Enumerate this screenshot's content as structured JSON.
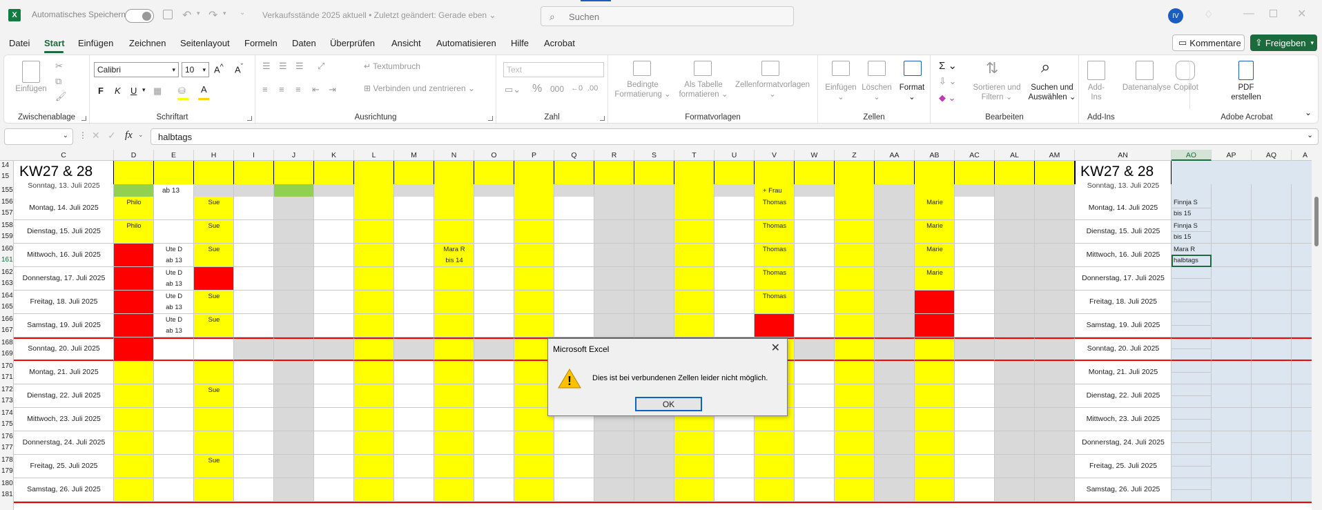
{
  "titlebar": {
    "logo": "X",
    "autosave_label": "Automatisches Speichern",
    "doc_title": "Verkaufsstände 2025 aktuell  •  Zuletzt geändert: Gerade eben ⌄",
    "search_placeholder": "Suchen",
    "avatar": "IV"
  },
  "menu": {
    "tabs": [
      "Datei",
      "Start",
      "Einfügen",
      "Zeichnen",
      "Seitenlayout",
      "Formeln",
      "Daten",
      "Überprüfen",
      "Ansicht",
      "Automatisieren",
      "Hilfe",
      "Acrobat"
    ],
    "active_tab": "Start",
    "kommentare": "Kommentare",
    "freigeben": "Freigeben"
  },
  "ribbon": {
    "groups": [
      "Zwischenablage",
      "Schriftart",
      "Ausrichtung",
      "Zahl",
      "Formatvorlagen",
      "Zellen",
      "Bearbeiten",
      "Add-Ins",
      "Adobe Acrobat"
    ],
    "font_name": "Calibri",
    "font_size": "10",
    "number_format": "Text",
    "paste_label": "Einfügen",
    "wrap_text": "Textumbruch",
    "merge_center": "Verbinden und zentrieren",
    "conditional_formatting": [
      "Bedingte",
      "Formatierung"
    ],
    "format_as_table": [
      "Als Tabelle",
      "formatieren"
    ],
    "cell_styles": "Zellenformatvorlagen",
    "insert_cells": "Einfügen",
    "delete_cells": "Löschen",
    "format_cells": "Format",
    "sort_filter": [
      "Sortieren und",
      "Filtern"
    ],
    "find_select": [
      "Suchen und",
      "Auswählen"
    ],
    "addins": [
      "Add-",
      "Ins"
    ],
    "data_analysis": "Datenanalyse",
    "copilot": "Copilot",
    "pdf": [
      "PDF",
      "erstellen"
    ],
    "bold": "F",
    "italic": "K",
    "underline": "U"
  },
  "formula_bar": {
    "name_box": "",
    "fx": "fx",
    "content": "halbtags"
  },
  "sheet": {
    "columns": [
      "C",
      "D",
      "E",
      "H",
      "I",
      "J",
      "K",
      "L",
      "M",
      "N",
      "O",
      "P",
      "Q",
      "R",
      "S",
      "T",
      "U",
      "V",
      "W",
      "Z",
      "AA",
      "AB",
      "AC",
      "AL",
      "AM",
      "AN",
      "AO",
      "AP",
      "AQ",
      "A"
    ],
    "header_label": "KW27 & 28",
    "frozen_rows": [
      "14",
      "15"
    ],
    "partial_row": {
      "row": "155",
      "date": "Sonntag, 13. Juli 2025",
      "E": "ab 13",
      "V": "+ Frau"
    },
    "days": [
      {
        "rows": [
          "156",
          "157"
        ],
        "date": "Montag, 14. Juli 2025",
        "D": "Philo",
        "E": [
          "",
          ""
        ],
        "H": "Sue",
        "N": [
          "",
          ""
        ],
        "V": "Thomas",
        "AB": "Marie",
        "AO": [
          "Finnja S",
          "bis 15"
        ]
      },
      {
        "rows": [
          "158",
          "159"
        ],
        "date": "Dienstag, 15. Juli 2025",
        "D": "Philo",
        "E": [
          "",
          ""
        ],
        "H": "Sue",
        "N": [
          "",
          ""
        ],
        "V": "Thomas",
        "AB": "Marie",
        "AO": [
          "Finnja S",
          "bis 15"
        ]
      },
      {
        "rows": [
          "160",
          "161"
        ],
        "date": "Mittwoch, 16. Juli 2025",
        "D": "",
        "E": [
          "Ute D",
          "ab 13"
        ],
        "H": "Sue",
        "N": [
          "Mara R",
          "bis 14"
        ],
        "V": "Thomas",
        "AB": "Marie",
        "AO": [
          "Mara R",
          "halbtags"
        ]
      },
      {
        "rows": [
          "162",
          "163"
        ],
        "date": "Donnerstag, 17. Juli 2025",
        "D": "",
        "E": [
          "Ute D",
          "ab 13"
        ],
        "H": "",
        "N": [
          "",
          ""
        ],
        "V": "Thomas",
        "AB": "Marie",
        "AO": [
          "",
          ""
        ]
      },
      {
        "rows": [
          "164",
          "165"
        ],
        "date": "Freitag, 18. Juli 2025",
        "D": "",
        "E": [
          "Ute D",
          "ab 13"
        ],
        "H": "Sue",
        "N": [
          "",
          ""
        ],
        "V": "Thomas",
        "AB": "",
        "AO": [
          "",
          ""
        ]
      },
      {
        "rows": [
          "166",
          "167"
        ],
        "date": "Samstag, 19. Juli 2025",
        "D": "",
        "E": [
          "Ute D",
          "ab 13"
        ],
        "H": "Sue",
        "N": [
          "",
          ""
        ],
        "V": "",
        "AB": "",
        "AO": [
          "",
          ""
        ]
      },
      {
        "rows": [
          "168",
          "169"
        ],
        "date": "Sonntag, 20. Juli 2025",
        "D": "",
        "E": [
          "",
          ""
        ],
        "H": "",
        "N": [
          "",
          ""
        ],
        "V": "",
        "AB": "",
        "AO": [
          "",
          ""
        ]
      },
      {
        "rows": [
          "170",
          "171"
        ],
        "date": "Montag, 21. Juli 2025",
        "D": "",
        "E": [
          "",
          ""
        ],
        "H": "",
        "N": [
          "",
          ""
        ],
        "V": "",
        "AB": "",
        "AO": [
          "",
          ""
        ]
      },
      {
        "rows": [
          "172",
          "173"
        ],
        "date": "Dienstag, 22. Juli 2025",
        "D": "",
        "E": [
          "",
          ""
        ],
        "H": "Sue",
        "N": [
          "",
          ""
        ],
        "V": "",
        "AB": "",
        "AO": [
          "",
          ""
        ]
      },
      {
        "rows": [
          "174",
          "175"
        ],
        "date": "Mittwoch, 23. Juli 2025",
        "D": "",
        "E": [
          "",
          ""
        ],
        "H": "",
        "N": [
          "",
          ""
        ],
        "V": "",
        "AB": "",
        "AO": [
          "",
          ""
        ]
      },
      {
        "rows": [
          "176",
          "177"
        ],
        "date": "Donnerstag, 24. Juli 2025",
        "D": "",
        "E": [
          "",
          ""
        ],
        "H": "",
        "N": [
          "",
          ""
        ],
        "V": "",
        "AB": "",
        "AO": [
          "",
          ""
        ]
      },
      {
        "rows": [
          "178",
          "179"
        ],
        "date": "Freitag, 25. Juli 2025",
        "D": "",
        "E": [
          "",
          ""
        ],
        "H": "Sue",
        "N": [
          "",
          ""
        ],
        "V": "",
        "AB": "",
        "AO": [
          "",
          ""
        ]
      },
      {
        "rows": [
          "180",
          "181"
        ],
        "date": "Samstag, 26. Juli 2025",
        "D": "",
        "E": [
          "",
          ""
        ],
        "H": "",
        "N": [
          "",
          ""
        ],
        "V": "",
        "AB": "",
        "AO": [
          "",
          ""
        ]
      }
    ]
  },
  "dialog": {
    "title": "Microsoft Excel",
    "message": "Dies ist bei verbundenen Zellen leider nicht möglich.",
    "ok": "OK",
    "warning_icon": "!"
  },
  "colors": {
    "yellow": "#ffff00",
    "red": "#ff0000",
    "grey": "#d9d9d9",
    "green": "#92d050",
    "accent": "#1c6b3c",
    "selected": "#dce6f1"
  }
}
